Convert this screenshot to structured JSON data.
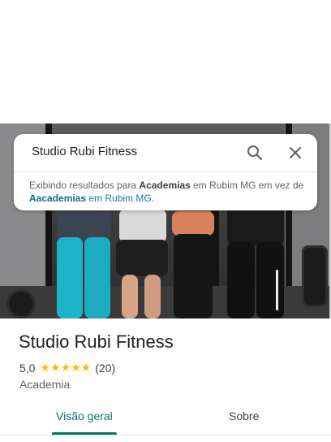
{
  "search": {
    "query": "Studio Rubi Fitness",
    "notice_prefix": "Exibindo resultados para ",
    "notice_term": "Academias",
    "notice_mid": " em Rubim MG em vez de ",
    "notice_link_term": "Aacademias",
    "notice_link_rest": " em Rubim MG."
  },
  "place": {
    "name": "Studio Rubi Fitness",
    "rating": "5,0",
    "stars": "★★★★★",
    "reviews": "(20)",
    "category": "Academia"
  },
  "tabs": [
    {
      "label": "Visão geral",
      "active": true
    },
    {
      "label": "Sobre",
      "active": false
    }
  ],
  "colors": {
    "accent": "#00796b",
    "star": "#fbbc04",
    "link": "#1a73a8"
  },
  "icons": {
    "search": "search-icon",
    "close": "close-icon"
  }
}
